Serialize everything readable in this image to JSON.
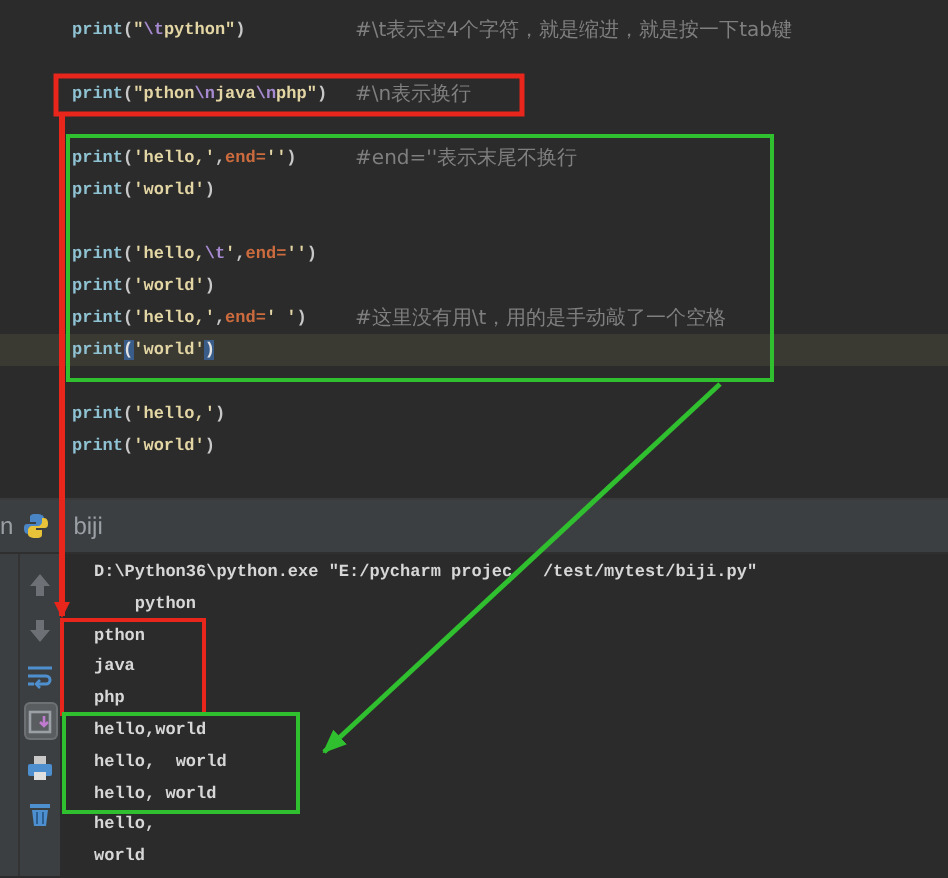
{
  "editor": {
    "lines": [
      {
        "kind": "code",
        "current": false,
        "tokens": [
          {
            "kind": "fn",
            "text": "print"
          },
          {
            "kind": "p",
            "text": "("
          },
          {
            "kind": "str",
            "text": "\""
          },
          {
            "kind": "esc",
            "text": "\\t"
          },
          {
            "kind": "str",
            "text": "python\""
          },
          {
            "kind": "p",
            "text": ")"
          }
        ],
        "comment": "#\\t表示空4个字符，就是缩进，就是按一下tab键"
      },
      {
        "kind": "blank"
      },
      {
        "kind": "code",
        "current": false,
        "tokens": [
          {
            "kind": "fn",
            "text": "print"
          },
          {
            "kind": "p",
            "text": "("
          },
          {
            "kind": "str",
            "text": "\"pthon"
          },
          {
            "kind": "esc",
            "text": "\\n"
          },
          {
            "kind": "str",
            "text": "java"
          },
          {
            "kind": "esc",
            "text": "\\n"
          },
          {
            "kind": "str",
            "text": "php\""
          },
          {
            "kind": "p",
            "text": ")"
          }
        ],
        "comment": "#\\n表示换行"
      },
      {
        "kind": "blank"
      },
      {
        "kind": "code",
        "current": false,
        "tokens": [
          {
            "kind": "fn",
            "text": "print"
          },
          {
            "kind": "p",
            "text": "("
          },
          {
            "kind": "str",
            "text": "'hello,'"
          },
          {
            "kind": "p",
            "text": ","
          },
          {
            "kind": "kw",
            "text": "end"
          },
          {
            "kind": "kw",
            "text": "="
          },
          {
            "kind": "str",
            "text": "''"
          },
          {
            "kind": "p",
            "text": ")"
          }
        ],
        "comment": "#end=''表示末尾不换行"
      },
      {
        "kind": "code",
        "current": false,
        "tokens": [
          {
            "kind": "fn",
            "text": "print"
          },
          {
            "kind": "p",
            "text": "("
          },
          {
            "kind": "str",
            "text": "'world'"
          },
          {
            "kind": "p",
            "text": ")"
          }
        ]
      },
      {
        "kind": "blank"
      },
      {
        "kind": "code",
        "current": false,
        "tokens": [
          {
            "kind": "fn",
            "text": "print"
          },
          {
            "kind": "p",
            "text": "("
          },
          {
            "kind": "str",
            "text": "'hello,"
          },
          {
            "kind": "esc",
            "text": "\\t"
          },
          {
            "kind": "str",
            "text": "'"
          },
          {
            "kind": "p",
            "text": ","
          },
          {
            "kind": "kw",
            "text": "end"
          },
          {
            "kind": "kw",
            "text": "="
          },
          {
            "kind": "str",
            "text": "''"
          },
          {
            "kind": "p",
            "text": ")"
          }
        ]
      },
      {
        "kind": "code",
        "current": false,
        "tokens": [
          {
            "kind": "fn",
            "text": "print"
          },
          {
            "kind": "p",
            "text": "("
          },
          {
            "kind": "str",
            "text": "'world'"
          },
          {
            "kind": "p",
            "text": ")"
          }
        ]
      },
      {
        "kind": "code",
        "current": false,
        "tokens": [
          {
            "kind": "fn",
            "text": "print"
          },
          {
            "kind": "p",
            "text": "("
          },
          {
            "kind": "str",
            "text": "'hello,'"
          },
          {
            "kind": "p",
            "text": ","
          },
          {
            "kind": "kw",
            "text": "end"
          },
          {
            "kind": "kw",
            "text": "="
          },
          {
            "kind": "str",
            "text": "' '"
          },
          {
            "kind": "p",
            "text": ")"
          }
        ],
        "comment": "#这里没有用\\t，用的是手动敲了一个空格"
      },
      {
        "kind": "code",
        "current": true,
        "tokens": [
          {
            "kind": "fn",
            "text": "print"
          },
          {
            "kind": "match",
            "text": "("
          },
          {
            "kind": "str",
            "text": "'world'"
          },
          {
            "kind": "match",
            "text": ")"
          }
        ]
      },
      {
        "kind": "blank"
      },
      {
        "kind": "code",
        "current": false,
        "tokens": [
          {
            "kind": "fn",
            "text": "print"
          },
          {
            "kind": "p",
            "text": "("
          },
          {
            "kind": "str",
            "text": "'hello,'"
          },
          {
            "kind": "p",
            "text": ")"
          }
        ]
      },
      {
        "kind": "code",
        "current": false,
        "tokens": [
          {
            "kind": "fn",
            "text": "print"
          },
          {
            "kind": "p",
            "text": "("
          },
          {
            "kind": "str",
            "text": "'world'"
          },
          {
            "kind": "p",
            "text": ")"
          }
        ]
      }
    ]
  },
  "run_panel": {
    "tab_cut": "n",
    "tab": "biji",
    "toolbar": [
      {
        "kind": "up",
        "selected": false
      },
      {
        "kind": "down",
        "selected": false
      },
      {
        "kind": "wrap",
        "selected": false
      },
      {
        "kind": "scroll",
        "selected": true
      },
      {
        "kind": "print",
        "selected": false
      },
      {
        "kind": "trash",
        "selected": false
      }
    ],
    "output": [
      {
        "parts": [
          "D:\\Python36\\python.exe \"E:/pycharm projec",
          "/test/mytest/biji.py\""
        ]
      },
      "\tpython",
      "pthon",
      "java",
      "php",
      "hello,world",
      "hello,\tworld",
      "hello, world",
      "hello,",
      "world"
    ]
  }
}
